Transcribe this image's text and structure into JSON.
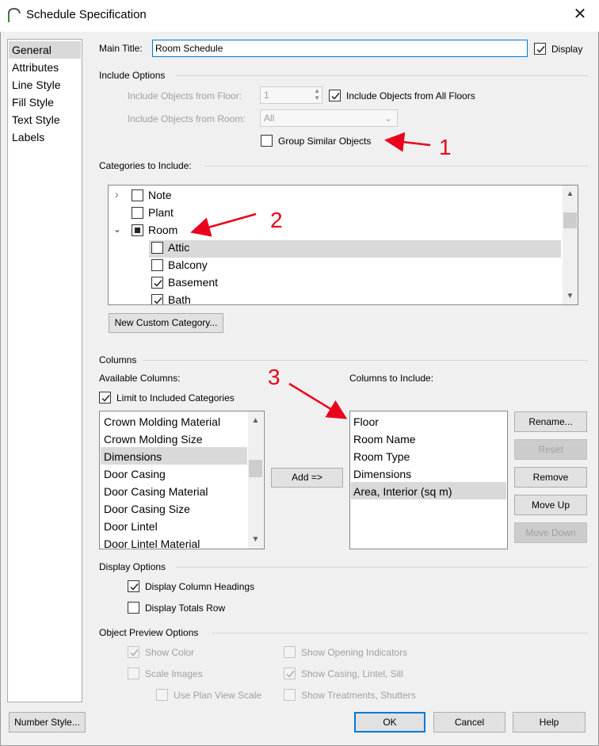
{
  "window": {
    "title": "Schedule Specification"
  },
  "nav": {
    "items": [
      "General",
      "Attributes",
      "Line Style",
      "Fill Style",
      "Text Style",
      "Labels"
    ]
  },
  "main_title": {
    "label": "Main Title:",
    "value": "Room Schedule",
    "display_label": "Display"
  },
  "include_options": {
    "heading": "Include Options",
    "floor_label": "Include Objects from Floor:",
    "floor_value": "1",
    "all_floors_label": "Include Objects from All Floors",
    "room_label": "Include Objects from Room:",
    "room_value": "All",
    "group_label": "Group Similar Objects"
  },
  "categories": {
    "heading": "Categories to Include:",
    "items": [
      "Note",
      "Plant",
      "Room",
      "Attic",
      "Balcony",
      "Basement",
      "Bath"
    ],
    "new_button": "New Custom Category..."
  },
  "columns": {
    "heading": "Columns",
    "available_label": "Available Columns:",
    "limit_label": "Limit to Included Categories",
    "available": [
      "Crown Molding Material",
      "Crown Molding Size",
      "Dimensions",
      "Door Casing",
      "Door Casing Material",
      "Door Casing Size",
      "Door Lintel",
      "Door Lintel Material"
    ],
    "add_button": "Add =>",
    "include_label": "Columns to Include:",
    "included": [
      "Floor",
      "Room Name",
      "Room Type",
      "Dimensions",
      "Area, Interior (sq m)"
    ],
    "rename": "Rename...",
    "reset": "Reset",
    "remove": "Remove",
    "move_up": "Move Up",
    "move_down": "Move Down"
  },
  "display_options": {
    "heading": "Display Options",
    "column_headings": "Display Column Headings",
    "totals_row": "Display Totals Row"
  },
  "preview_options": {
    "heading": "Object Preview Options",
    "show_color": "Show Color",
    "scale_images": "Scale Images",
    "plan_view_scale": "Use Plan View Scale",
    "opening_indicators": "Show Opening Indicators",
    "casing": "Show Casing, Lintel, Sill",
    "treatments": "Show Treatments, Shutters"
  },
  "footer": {
    "number_style": "Number Style...",
    "ok": "OK",
    "cancel": "Cancel",
    "help": "Help"
  },
  "annotations": [
    "1",
    "2",
    "3"
  ],
  "colors": {
    "annotation": "#e8001c",
    "focus": "#0078d7",
    "selection": "#d9d9d9"
  }
}
